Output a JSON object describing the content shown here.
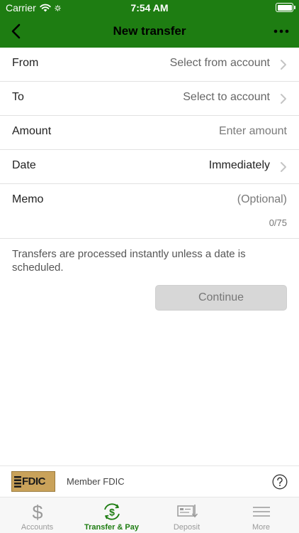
{
  "status": {
    "carrier": "Carrier",
    "time": "7:54 AM"
  },
  "nav": {
    "title": "New transfer",
    "back_icon": "chevron-left-icon",
    "more_icon": "more-dots-icon"
  },
  "form": {
    "from": {
      "label": "From",
      "value": "Select from account"
    },
    "to": {
      "label": "To",
      "value": "Select to account"
    },
    "amount": {
      "label": "Amount",
      "placeholder": "Enter amount"
    },
    "date": {
      "label": "Date",
      "value": "Immediately"
    },
    "memo": {
      "label": "Memo",
      "placeholder": "(Optional)",
      "counter": "0/75"
    }
  },
  "info_text": "Transfers are processed instantly unless a date is scheduled.",
  "continue_label": "Continue",
  "fdic": {
    "logo_text": "FDIC",
    "member_text": "Member FDIC"
  },
  "tabs": [
    {
      "label": "Accounts",
      "icon": "dollar-icon"
    },
    {
      "label": "Transfer & Pay",
      "icon": "transfer-dollar-icon"
    },
    {
      "label": "Deposit",
      "icon": "check-deposit-icon"
    },
    {
      "label": "More",
      "icon": "menu-icon"
    }
  ],
  "colors": {
    "brand_green": "#1e7d12",
    "disabled_button": "#d7d7d7",
    "fdic_gold": "#c9a25a"
  }
}
